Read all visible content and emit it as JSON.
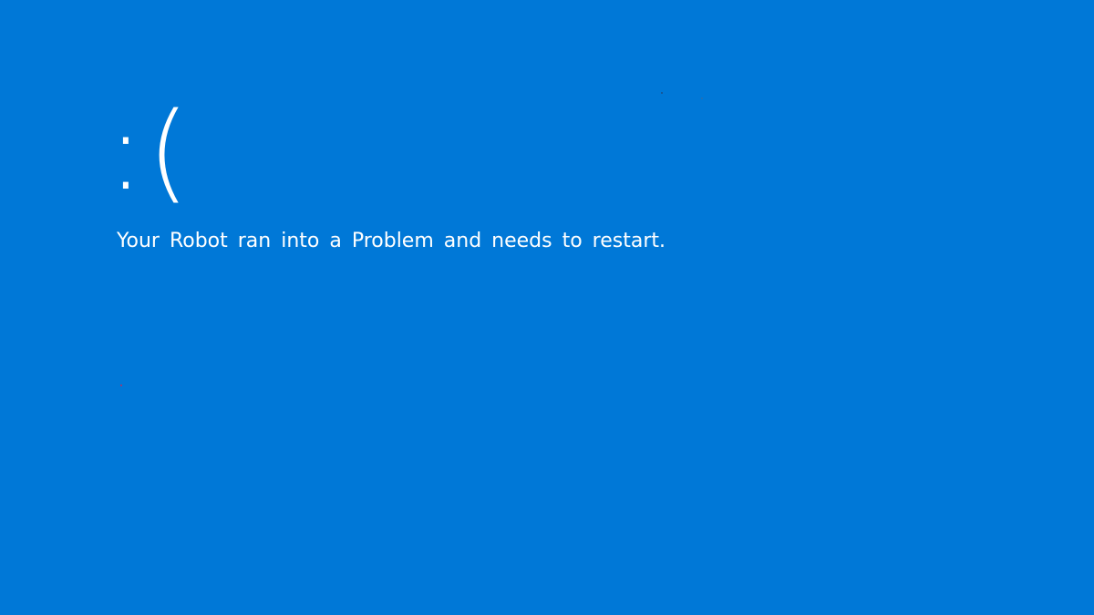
{
  "bsod": {
    "face": ":(",
    "message": "Your Robot ran into a Problem and needs to restart."
  },
  "colors": {
    "background": "#0078d7",
    "text": "#ffffff"
  }
}
